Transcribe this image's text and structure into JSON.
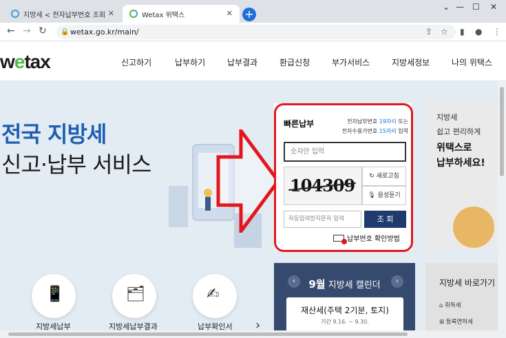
{
  "browser": {
    "tabs": [
      {
        "title": "지방세 < 전자납부번호 조회·납부",
        "active": false
      },
      {
        "title": "Wetax 위택스",
        "active": true
      }
    ],
    "url": "wetax.go.kr/main/"
  },
  "site": {
    "logo": {
      "pre": "w",
      "e": "e",
      "post": "tax"
    },
    "menu": [
      "신고하기",
      "납부하기",
      "납부결과",
      "환급신청",
      "부가서비스",
      "지방세정보",
      "나의 위택스"
    ]
  },
  "hero": {
    "headline1": "전국 지방세",
    "headline2": "신고·납부 서비스"
  },
  "quickpay": {
    "title": "빠른납부",
    "desc1_pre": "전자납부번호 ",
    "desc1_hl": "19자리",
    "desc1_post": " 또는",
    "desc2_pre": "전자수용가번호 ",
    "desc2_hl": "15자리",
    "desc2_post": " 입력",
    "input_placeholder": "숫자만 입력",
    "captcha_code": "104309",
    "refresh_label": "새로고침",
    "audio_label": "음성듣기",
    "captcha_placeholder": "자동입력방지문자 입력",
    "search_label": "조 회",
    "how_label": "납부번호 확인방법"
  },
  "promo": {
    "line1": "지방세",
    "line2": "쉽고 편리하게",
    "line3": "위택스로",
    "line4": "납부하세요!"
  },
  "calendar": {
    "month": "9월",
    "title": "지방세 캘린더",
    "event": "재산세(주택 2기분, 토지)",
    "period": "기간 9.16. ~ 9.30."
  },
  "shortcuts": {
    "title": "지방세 바로가기",
    "items": [
      "취득세",
      "등록면허세"
    ]
  },
  "quicklinks": [
    {
      "label": "지방세납부"
    },
    {
      "label": "지방세납부결과"
    },
    {
      "label": "납부확인서"
    }
  ]
}
